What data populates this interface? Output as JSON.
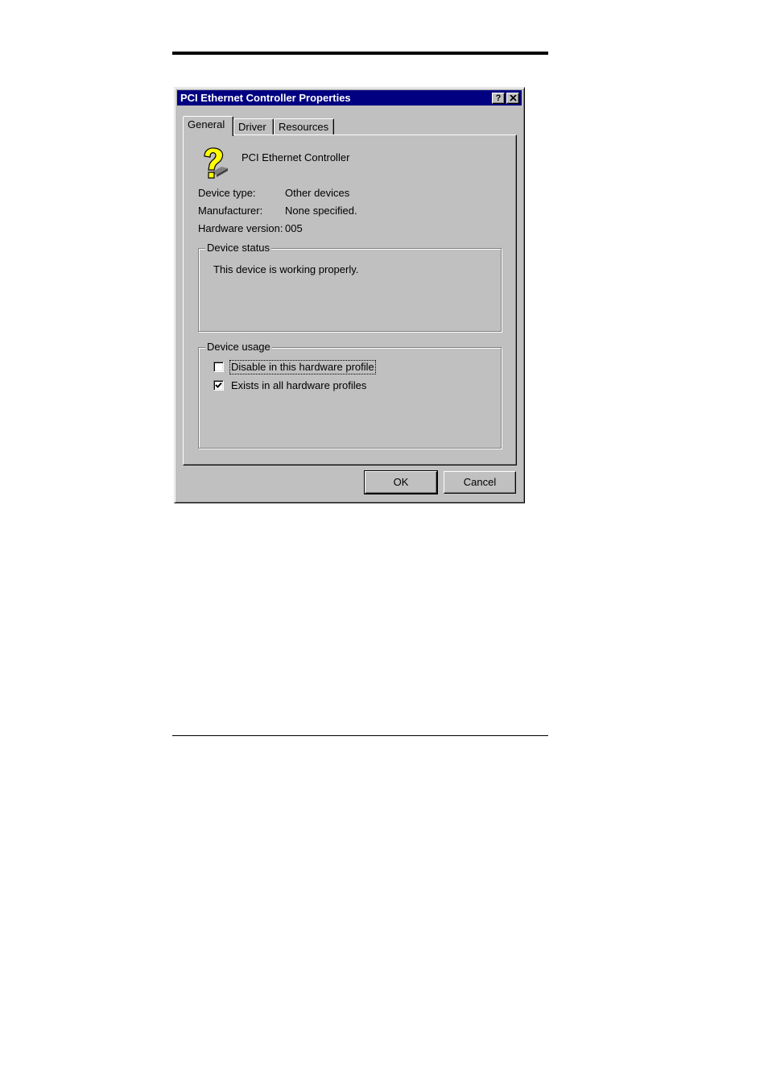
{
  "window": {
    "title": "PCI Ethernet Controller Properties",
    "help_label": "?",
    "close_icon": "close-icon"
  },
  "tabs": [
    {
      "label": "General",
      "active": true
    },
    {
      "label": "Driver",
      "active": false
    },
    {
      "label": "Resources",
      "active": false
    }
  ],
  "device": {
    "icon": "question-mark-device-icon",
    "name": "PCI Ethernet Controller",
    "properties": [
      {
        "label": "Device type:",
        "value": "Other devices"
      },
      {
        "label": "Manufacturer:",
        "value": "None specified."
      },
      {
        "label": "Hardware version:",
        "value": "005"
      }
    ]
  },
  "device_status": {
    "legend": "Device status",
    "text": "This device is working properly."
  },
  "device_usage": {
    "legend": "Device usage",
    "options": [
      {
        "label": "Disable in this hardware profile",
        "checked": false
      },
      {
        "label": "Exists in all hardware profiles",
        "checked": true
      }
    ]
  },
  "buttons": {
    "ok": "OK",
    "cancel": "Cancel"
  },
  "colors": {
    "titlebar": "#000080",
    "face": "#c0c0c0",
    "icon_yellow": "#ffff00"
  }
}
